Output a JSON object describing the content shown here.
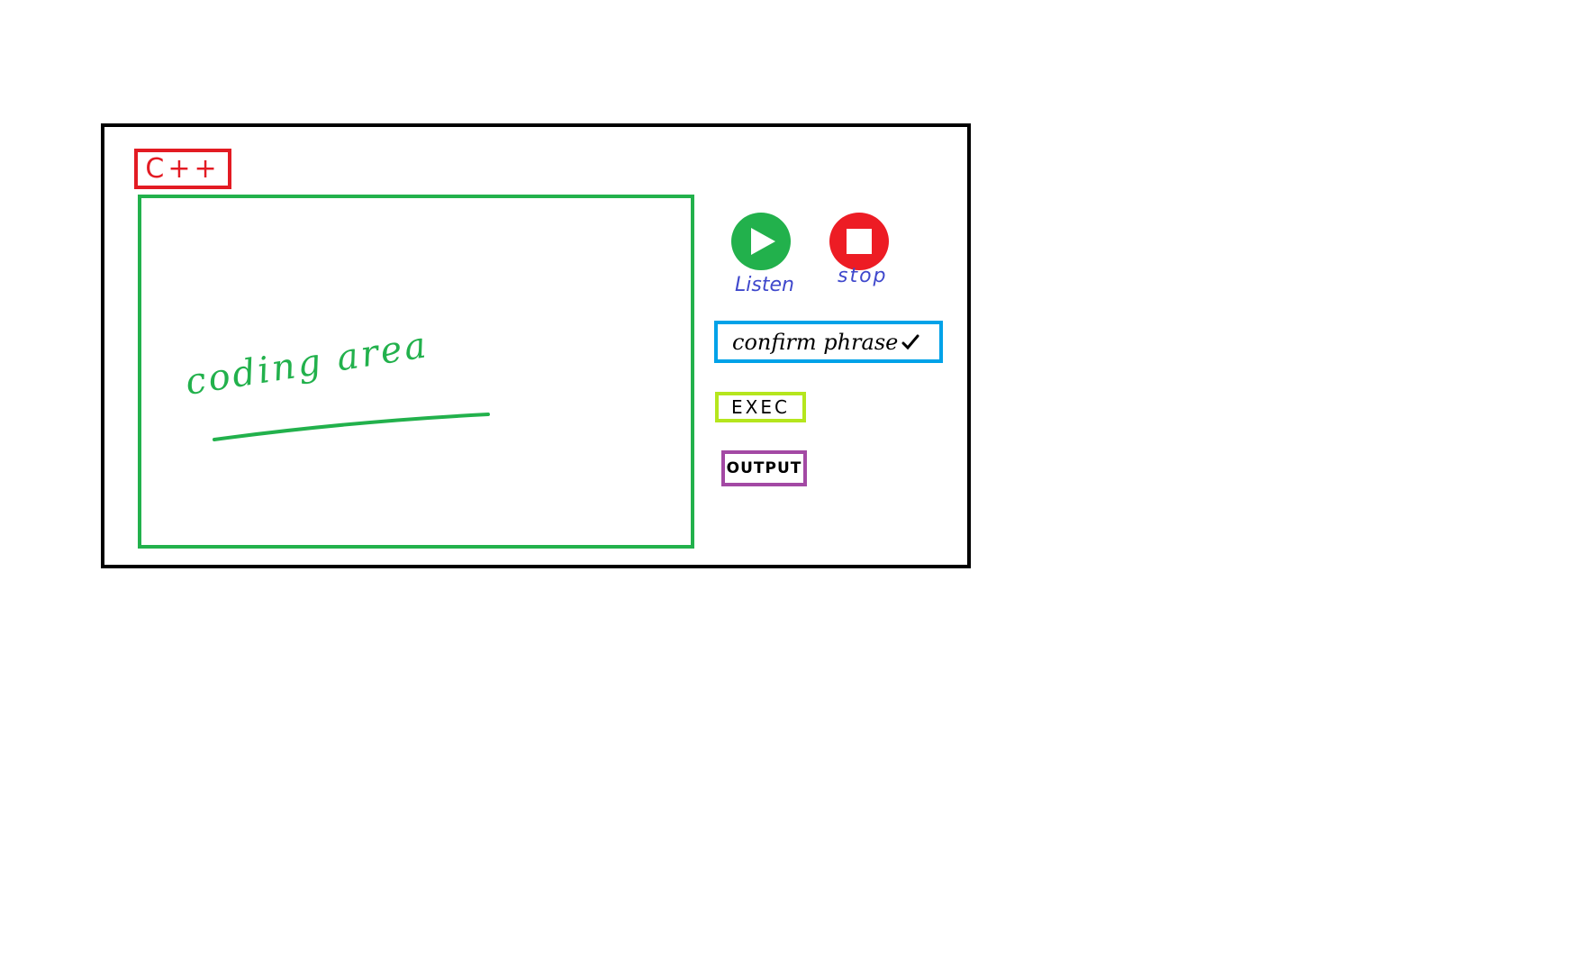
{
  "header": {
    "language_label": "C++"
  },
  "editor": {
    "placeholder_label": "coding area"
  },
  "controls": {
    "listen_label": "Listen",
    "stop_label": "stop",
    "confirm_phrase_label": "confirm phrase",
    "confirm_check_icon": "check-icon",
    "exec_label": "EXEC",
    "output_label": "OUTPUT"
  },
  "colors": {
    "frame": "#000000",
    "language_border": "#e31b23",
    "coding_area": "#22b14c",
    "listen_button": "#22b14c",
    "stop_button": "#ed1c24",
    "captions": "#3f48cc",
    "confirm_border": "#00a2e8",
    "exec_border": "#b5e61d",
    "output_border": "#a349a4"
  }
}
